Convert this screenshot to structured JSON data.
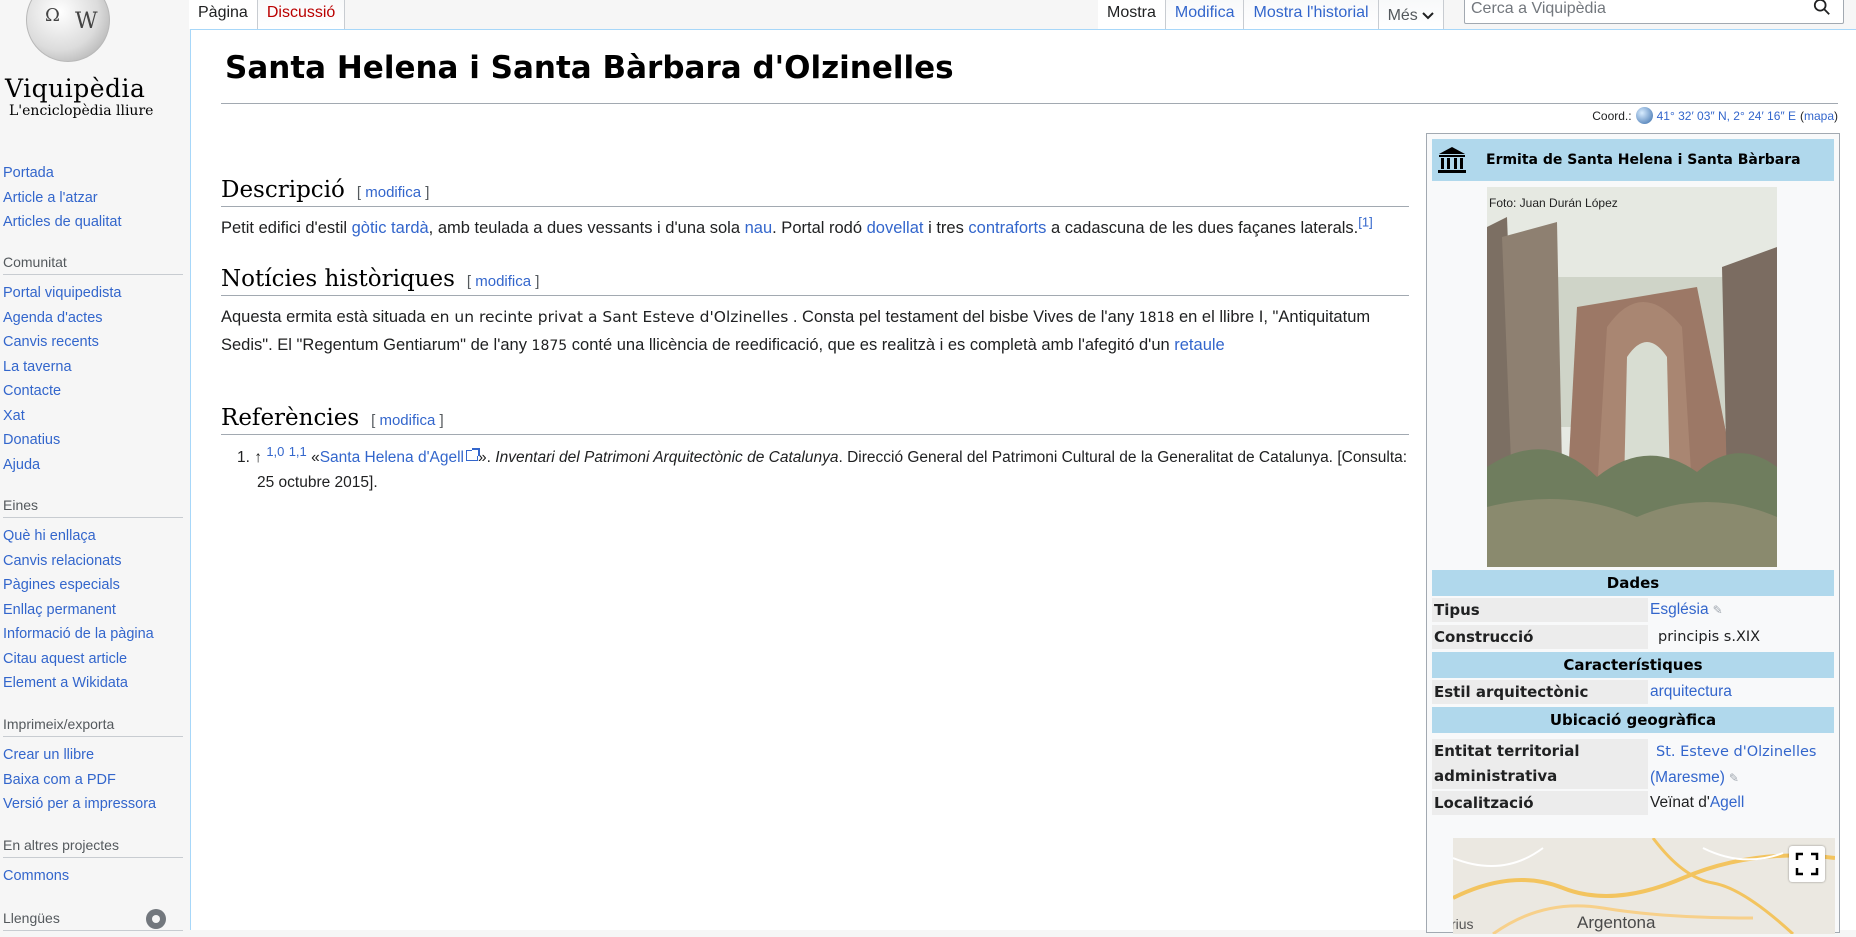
{
  "sidebar": {
    "logo": {
      "wordmark": "Viquipèdia",
      "tagline": "L'enciclopèdia lliure",
      "globe_glyphs": [
        "Ω",
        "W"
      ]
    },
    "navigation": [
      "Portada",
      "Article a l'atzar",
      "Articles de qualitat"
    ],
    "community": {
      "heading": "Comunitat",
      "items": [
        "Portal viquipedista",
        "Agenda d'actes",
        "Canvis recents",
        "La taverna",
        "Contacte",
        "Xat",
        "Donatius",
        "Ajuda"
      ]
    },
    "tools": {
      "heading": "Eines",
      "items": [
        "Què hi enllaça",
        "Canvis relacionats",
        "Pàgines especials",
        "Enllaç permanent",
        "Informació de la pàgina",
        "Citau aquest article",
        "Element a Wikidata"
      ]
    },
    "print": {
      "heading": "Imprimeix/exporta",
      "items": [
        "Crear un llibre",
        "Baixa com a PDF",
        "Versió per a impressora"
      ]
    },
    "other_projects": {
      "heading": "En altres projectes",
      "items": [
        "Commons"
      ]
    },
    "languages": {
      "heading": "Llengües"
    }
  },
  "tabs": {
    "left": [
      "Pàgina",
      "Discussió"
    ],
    "right": [
      "Mostra",
      "Modifica",
      "Mostra l'historial"
    ],
    "more": "Més"
  },
  "search": {
    "placeholder": "Cerca a Viquipèdia",
    "value": ""
  },
  "article": {
    "title": "Santa Helena i Santa Bàrbara d'Olzinelles",
    "coords": {
      "label": "Coord.:",
      "value": "41° 32′ 03″ N, 2° 24′ 16″ E",
      "map_link": "mapa"
    },
    "edit_label": "modifica",
    "sections": {
      "descripcio": {
        "heading": "Descripció",
        "text": [
          "Petit edifici d'estil ",
          "gòtic tardà",
          ", amb teulada a dues vessants i d'una sola ",
          "nau",
          ". Portal rodó ",
          "dovellat",
          " i tres ",
          "contraforts",
          " a cadascuna de les dues façanes laterals.",
          "[1]"
        ]
      },
      "historia": {
        "heading": "Notícies històriques",
        "text": [
          "Aquesta ermita està situada ",
          "en un recinte privat a Sant Esteve d'Olzinelles",
          " . Consta pel testament del bisbe Vives de l'any ",
          "1818",
          " en el llibre I, \"Antiquitatum Sedis\". El \"Regentum Gentiarum\" de l'any ",
          "1875",
          " conté una llicència de reedificació, que es realitzà i es completà amb l'afegitó d'un ",
          "retaule"
        ]
      },
      "referencies": {
        "heading": "Referències",
        "items": [
          {
            "num": "1.",
            "arrow": "↑",
            "backrefs": [
              "1,0",
              "1,1"
            ],
            "open": "«",
            "link": "Santa Helena d'Agell",
            "close": "».",
            "work": "Inventari del Patrimoni Arquitectònic de Catalunya",
            "publisher": ". Direcció General del Patrimoni Cultural de la Generalitat de Catalunya.",
            "accessed": "[Consulta: 25 octubre 2015]."
          }
        ]
      }
    }
  },
  "infobox": {
    "title": "Ermita de Santa Helena i Santa Bàrbara",
    "photo_caption": "Foto: Juan Durán López",
    "sections": [
      "Dades",
      "Característiques",
      "Ubicació geogràfica"
    ],
    "rows": {
      "tipus": {
        "key": "Tipus",
        "value": "Església"
      },
      "construccio": {
        "key": "Construcció",
        "value": "principis s.XIX"
      },
      "estil": {
        "key": "Estil arquitectònic",
        "value": "arquitectura"
      },
      "entitat": {
        "key": "Entitat territorial administrativa",
        "value1": "St. Esteve d'Olzinelles",
        "value2": "(Maresme)"
      },
      "localitzacio": {
        "key": "Localització",
        "value_plain": "Veïnat d'",
        "value_link": "Agell"
      }
    },
    "map": {
      "town": "Argentona",
      "partial": "rius"
    },
    "colors": {
      "header": "#b0d8ec",
      "link": "#3366cc"
    }
  }
}
